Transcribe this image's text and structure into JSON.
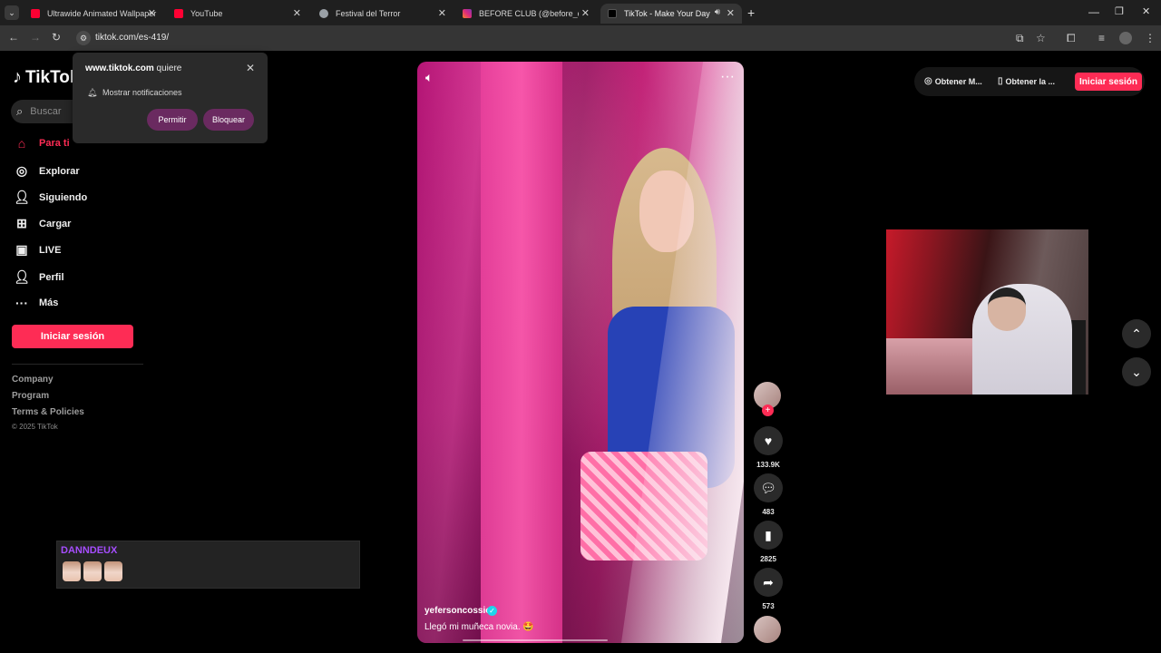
{
  "browser": {
    "tabs": [
      {
        "title": "Ultrawide Animated Wallpaper",
        "favicon_color": "#ff0033",
        "active": false
      },
      {
        "title": "YouTube",
        "favicon_color": "#ff0033",
        "active": false
      },
      {
        "title": "Festival del Terror",
        "favicon_color": "#9aa0a6",
        "active": false
      },
      {
        "title": "BEFORE CLUB (@before_col) •",
        "favicon_color": "#dd2a7b",
        "active": false
      },
      {
        "title": "TikTok - Make Your Day",
        "favicon_color": "#000000",
        "active": true
      }
    ],
    "new_tab_label": "+",
    "url": "tiktok.com/es-419/"
  },
  "permission_popup": {
    "site": "www.tiktok.com",
    "verb": "quiere",
    "permission_text": "Mostrar notificaciones",
    "allow_label": "Permitir",
    "block_label": "Bloquear"
  },
  "sidebar": {
    "logo": "TikTok",
    "search_placeholder": "Buscar",
    "nav": [
      {
        "label": "Para ti",
        "icon": "home-icon",
        "active": true
      },
      {
        "label": "Explorar",
        "icon": "compass-icon",
        "active": false
      },
      {
        "label": "Siguiendo",
        "icon": "following-icon",
        "active": false
      },
      {
        "label": "Cargar",
        "icon": "upload-icon",
        "active": false
      },
      {
        "label": "LIVE",
        "icon": "live-icon",
        "active": false
      },
      {
        "label": "Perfil",
        "icon": "profile-icon",
        "active": false
      },
      {
        "label": "Más",
        "icon": "more-icon",
        "active": false
      }
    ],
    "login_label": "Iniciar sesión",
    "footer_links": [
      "Company",
      "Program",
      "Terms & Policies"
    ],
    "copyright": "© 2025 TikTok"
  },
  "header": {
    "get_coins": "Obtener M...",
    "get_app": "Obtener la ...",
    "login_label": "Iniciar sesión"
  },
  "video": {
    "author": "yefersoncossio",
    "verified": true,
    "caption": "Llegó mi muñeca novia. 🤩",
    "likes": "133.9K",
    "comments": "483",
    "saves": "2825",
    "shares": "573"
  },
  "chat": {
    "username": "DANNDEUX",
    "emote_count": 3
  },
  "colors": {
    "brand": "#fe2c55",
    "chat_name": "#a64dff"
  }
}
